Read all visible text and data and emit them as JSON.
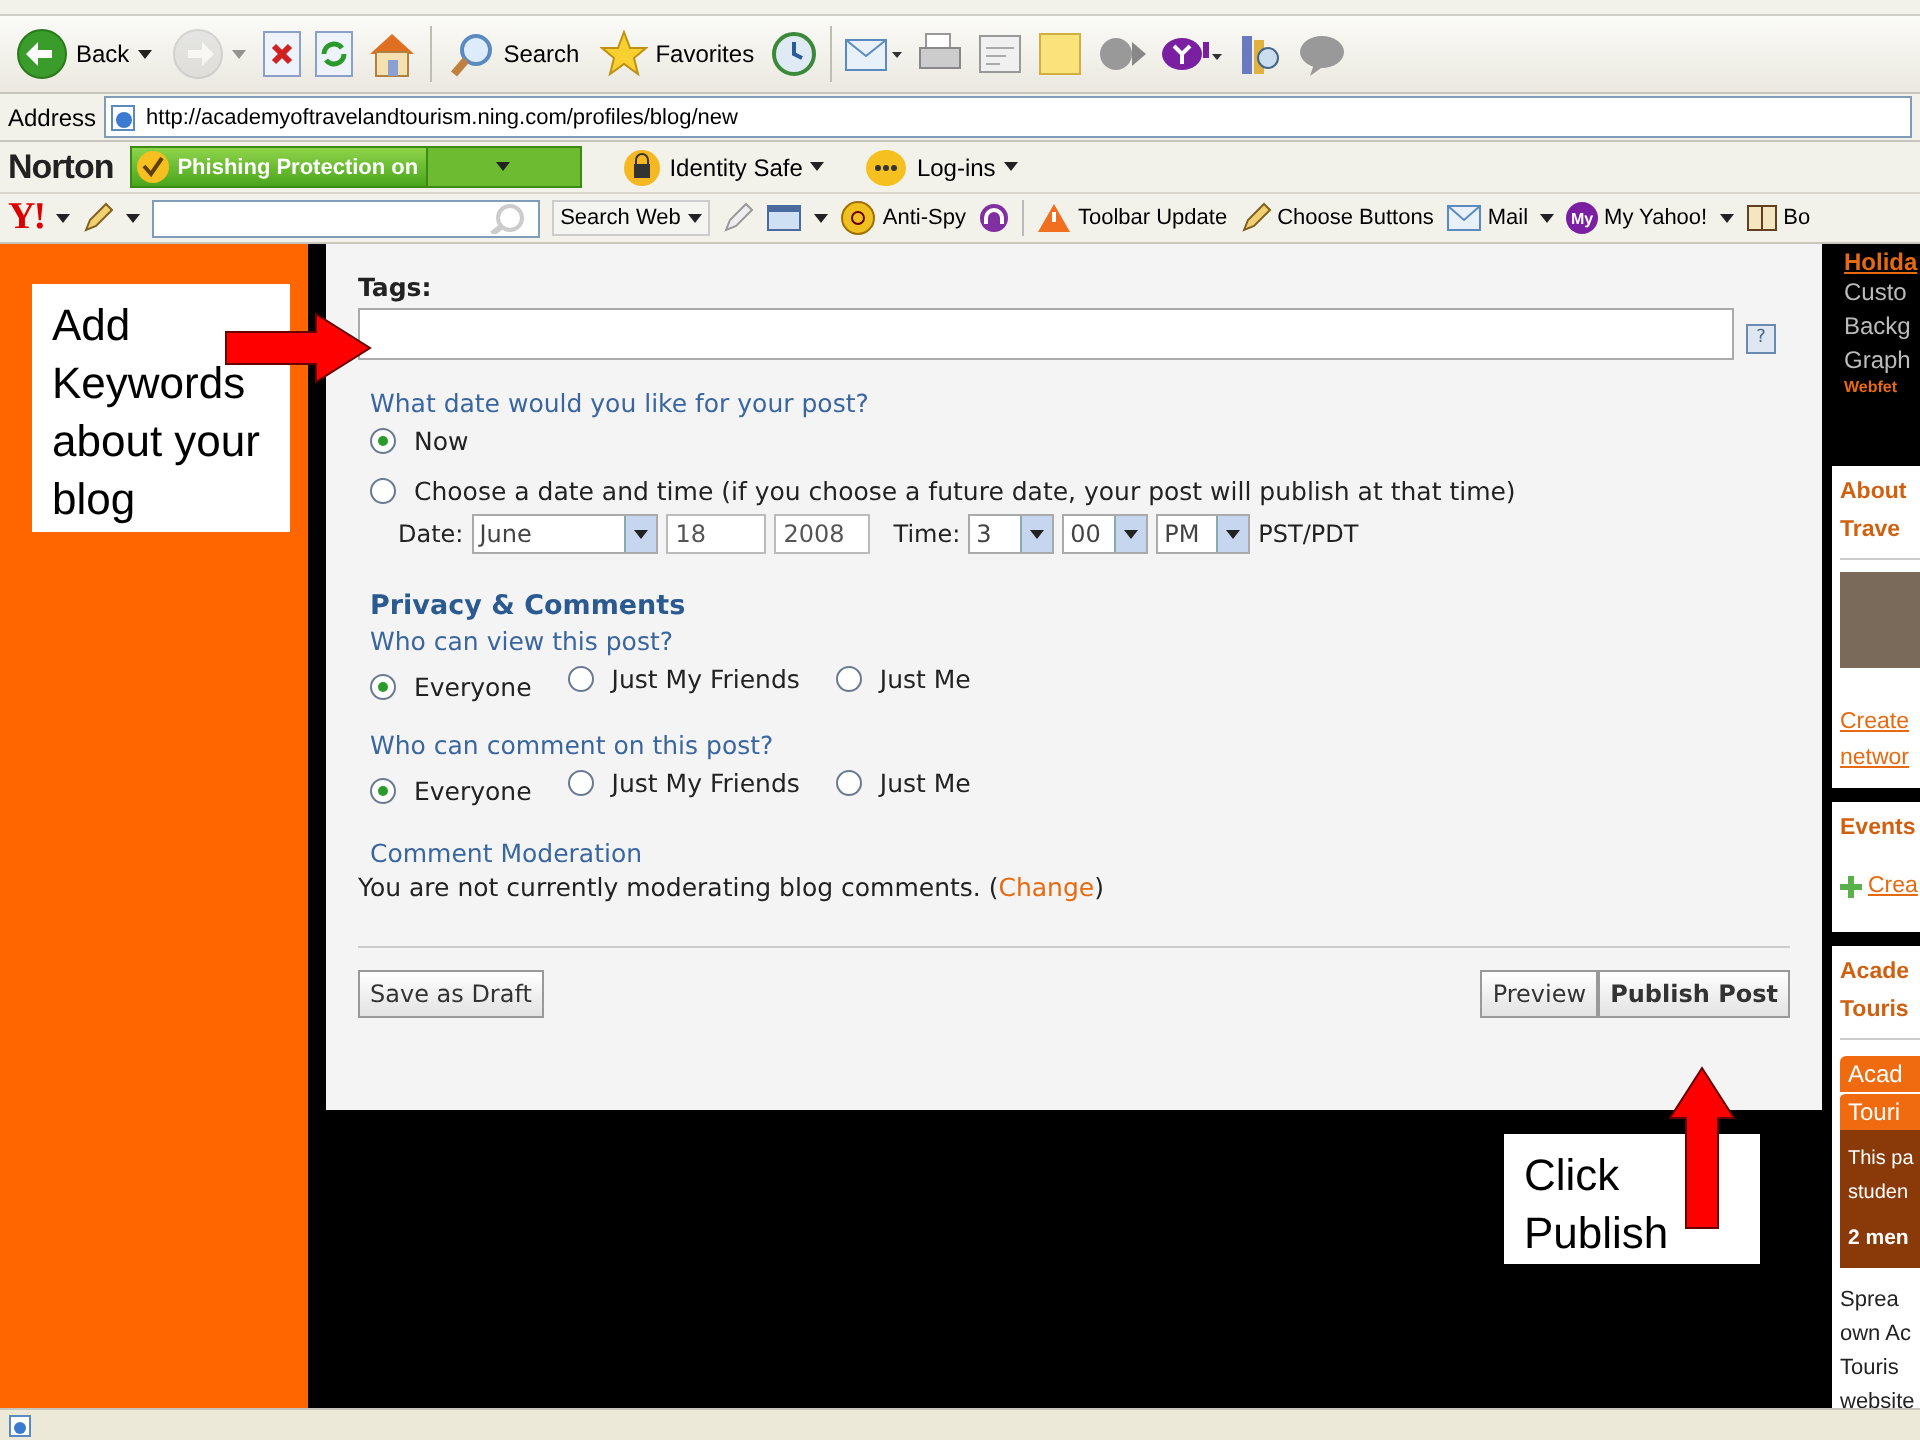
{
  "toolbar": {
    "buttons": [
      {
        "kind": "back",
        "label": "Back",
        "disabled": false
      },
      {
        "kind": "forward",
        "disabled": true
      },
      {
        "kind": "stop"
      },
      {
        "kind": "refresh"
      },
      {
        "kind": "home"
      },
      {
        "kind": "search",
        "label": "Search"
      },
      {
        "kind": "favorites",
        "label": "Favorites"
      },
      {
        "kind": "history"
      },
      {
        "kind": "mail"
      },
      {
        "kind": "print"
      },
      {
        "kind": "edit"
      },
      {
        "kind": "note"
      },
      {
        "kind": "media"
      },
      {
        "kind": "yahoo"
      },
      {
        "kind": "research"
      },
      {
        "kind": "messenger"
      }
    ]
  },
  "address_bar": {
    "label": "Address",
    "url": "http://academyoftravelandtourism.ning.com/profiles/blog/new"
  },
  "norton_bar": {
    "logo": "Norton",
    "phishing": "Phishing Protection on",
    "items": [
      "Identity Safe",
      "Log-ins"
    ]
  },
  "yahoo_bar": {
    "logo": "Y!",
    "search_button": "Search Web",
    "items": [
      {
        "kind": "antispy",
        "label": "Anti-Spy"
      },
      {
        "kind": "update",
        "label": "Toolbar Update"
      },
      {
        "kind": "pencil",
        "label": "Choose Buttons"
      },
      {
        "kind": "mail",
        "label": "Mail"
      },
      {
        "kind": "myyahoo",
        "badge": "My",
        "label": "My Yahoo!"
      },
      {
        "kind": "book",
        "label": "Bo"
      }
    ]
  },
  "form": {
    "tags_label": "Tags:",
    "help": "?",
    "date_question": "What date would you like for your post?",
    "date_options": [
      {
        "label": "Now",
        "selected": true
      },
      {
        "label": "Choose a date and time (if you choose a future date, your post will publish at that time)",
        "selected": false
      }
    ],
    "date_label": "Date:",
    "month": "June",
    "day": "18",
    "year": "2008",
    "time_label": "Time:",
    "hour": "3",
    "minute": "00",
    "ampm": "PM",
    "zone": "PST/PDT",
    "privacy_heading": "Privacy & Comments",
    "groups": [
      {
        "question": "Who can view this post?",
        "options": [
          {
            "label": "Everyone",
            "selected": true
          },
          {
            "label": "Just My Friends",
            "selected": false
          },
          {
            "label": "Just Me",
            "selected": false
          }
        ]
      },
      {
        "question": "Who can comment on this post?",
        "options": [
          {
            "label": "Everyone",
            "selected": true
          },
          {
            "label": "Just My Friends",
            "selected": false
          },
          {
            "label": "Just Me",
            "selected": false
          }
        ]
      }
    ],
    "moderation_heading": "Comment Moderation",
    "moderation_text": "You are not currently moderating blog comments. (",
    "moderation_link": "Change",
    "moderation_end": ")",
    "left_buttons": [
      "Save as Draft"
    ],
    "right_buttons": [
      {
        "label": "Preview",
        "primary": false
      },
      {
        "label": "Publish Post",
        "primary": true
      }
    ]
  },
  "sidebar": {
    "cards": [
      {
        "kind": "dark",
        "lines": [
          {
            "kind": "title",
            "text": "Holida"
          },
          {
            "kind": "plain",
            "text": "Custo"
          },
          {
            "kind": "plain",
            "text": "Backg"
          },
          {
            "kind": "plain",
            "text": "Graph"
          },
          {
            "kind": "small",
            "text": "Webfet"
          }
        ]
      },
      {
        "kind": "light",
        "lines": [
          {
            "kind": "heading",
            "text": "About"
          },
          {
            "kind": "heading",
            "text": "Trave"
          },
          {
            "kind": "photo"
          },
          {
            "kind": "link",
            "text": "Create"
          },
          {
            "kind": "link",
            "text": "networ"
          }
        ]
      },
      {
        "kind": "light",
        "lines": [
          {
            "kind": "heading",
            "text": "Events"
          },
          {
            "kind": "add",
            "text": "Crea"
          }
        ]
      },
      {
        "kind": "light",
        "lines": [
          {
            "kind": "heading",
            "text": "Acade"
          },
          {
            "kind": "heading",
            "text": "Touris"
          },
          {
            "kind": "banner",
            "text": "Acad"
          },
          {
            "kind": "banner",
            "text": "Touri"
          },
          {
            "kind": "brown",
            "text": "This pa"
          },
          {
            "kind": "brown",
            "text": "studen"
          },
          {
            "kind": "brownbold",
            "text": "2 men"
          },
          {
            "kind": "text",
            "text": "Sprea"
          },
          {
            "kind": "text",
            "text": "own Ac"
          },
          {
            "kind": "text",
            "text": "Touris"
          },
          {
            "kind": "text",
            "text": "website"
          }
        ]
      }
    ]
  },
  "callouts": [
    {
      "kind": "keywords",
      "text": "Add Keywords about your blog"
    },
    {
      "kind": "publish",
      "text": "Click Publish"
    }
  ]
}
